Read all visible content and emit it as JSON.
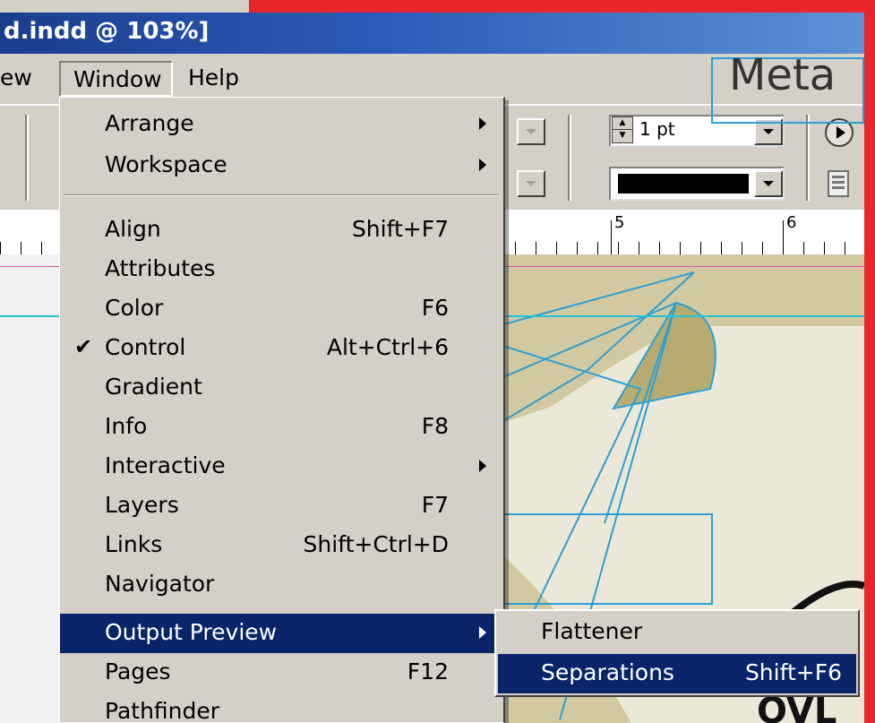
{
  "window": {
    "title": "d.indd @ 103%]"
  },
  "menubar": {
    "items": [
      "ew",
      "Window",
      "Help"
    ],
    "open_index": 1
  },
  "toolbar": {
    "stroke_weight": "1 pt",
    "stroke_color": "#000000"
  },
  "ruler": {
    "numbers": [
      "5",
      "6"
    ]
  },
  "canvas": {
    "frame_text": "Meta",
    "accent_line": "#24c2d6",
    "guide_line": "#d74fa3"
  },
  "window_menu": {
    "groups": [
      [
        {
          "label": "Arrange",
          "submenu": true
        },
        {
          "label": "Workspace",
          "submenu": true
        }
      ],
      [
        {
          "label": "Align",
          "shortcut": "Shift+F7"
        },
        {
          "label": "Attributes"
        },
        {
          "label": "Color",
          "shortcut": "F6"
        },
        {
          "label": "Control",
          "shortcut": "Alt+Ctrl+6",
          "checked": true
        },
        {
          "label": "Gradient"
        },
        {
          "label": "Info",
          "shortcut": "F8"
        },
        {
          "label": "Interactive",
          "submenu": true
        },
        {
          "label": "Layers",
          "shortcut": "F7"
        },
        {
          "label": "Links",
          "shortcut": "Shift+Ctrl+D"
        },
        {
          "label": "Navigator"
        },
        {
          "label": "Output Preview",
          "submenu": true,
          "highlighted": true
        },
        {
          "label": "Pages",
          "shortcut": "F12"
        },
        {
          "label": "Pathfinder"
        }
      ]
    ],
    "check_glyph": "✔"
  },
  "output_preview_submenu": {
    "items": [
      {
        "label": "Flattener"
      },
      {
        "label": "Separations",
        "shortcut": "Shift+F6",
        "highlighted": true
      }
    ]
  },
  "colors": {
    "highlight": "#0a246a",
    "frame_red": "#e8262c",
    "title_blue": "#1b3d8f"
  }
}
